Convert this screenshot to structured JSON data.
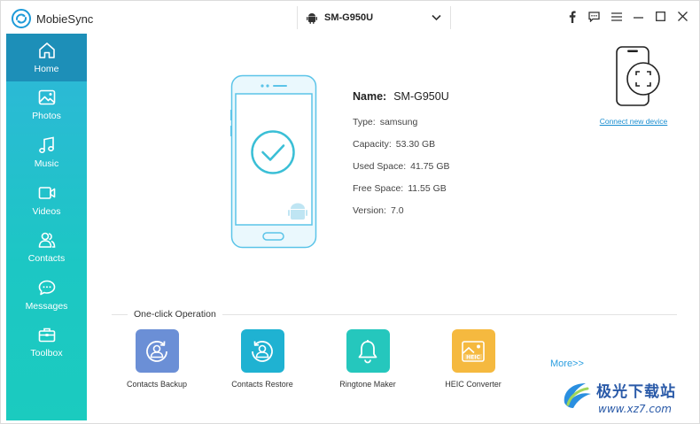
{
  "app": {
    "name": "MobieSync",
    "accent": "#1d8fb8",
    "sidebar_gradient_top": "#2fb6da",
    "sidebar_gradient_bottom": "#1bcbbf"
  },
  "device_selector": {
    "icon": "android-icon",
    "selected": "SM-G950U"
  },
  "window_controls": [
    "facebook-icon",
    "feedback-icon",
    "menu-icon",
    "minimize-icon",
    "maximize-icon",
    "close-icon"
  ],
  "sidebar": {
    "items": [
      {
        "label": "Home",
        "icon": "home-icon",
        "active": true
      },
      {
        "label": "Photos",
        "icon": "photo-icon",
        "active": false
      },
      {
        "label": "Music",
        "icon": "music-icon",
        "active": false
      },
      {
        "label": "Videos",
        "icon": "video-icon",
        "active": false
      },
      {
        "label": "Contacts",
        "icon": "contacts-icon",
        "active": false
      },
      {
        "label": "Messages",
        "icon": "messages-icon",
        "active": false
      },
      {
        "label": "Toolbox",
        "icon": "toolbox-icon",
        "active": false
      }
    ]
  },
  "device_info": {
    "name_label": "Name:",
    "name_value": "SM-G950U",
    "type_label": "Type:",
    "type_value": "samsung",
    "capacity_label": "Capacity:",
    "capacity_value": "53.30 GB",
    "used_label": "Used Space:",
    "used_value": "41.75 GB",
    "free_label": "Free Space:",
    "free_value": "11.55 GB",
    "version_label": "Version:",
    "version_value": "7.0"
  },
  "connect": {
    "link": "Connect new device"
  },
  "one_click": {
    "title": "One-click Operation",
    "operations": [
      {
        "label": "Contacts Backup",
        "icon": "contacts-backup-icon",
        "color": "#6b8fd6"
      },
      {
        "label": "Contacts Restore",
        "icon": "contacts-restore-icon",
        "color": "#1fb2d2"
      },
      {
        "label": "Ringtone Maker",
        "icon": "bell-icon",
        "color": "#25c7bd"
      },
      {
        "label": "HEIC Converter",
        "icon": "heic-icon",
        "color": "#f5b93f"
      }
    ],
    "more": "More>>"
  },
  "watermark": {
    "text": "极光下载站",
    "url": "www.xz7.com"
  }
}
